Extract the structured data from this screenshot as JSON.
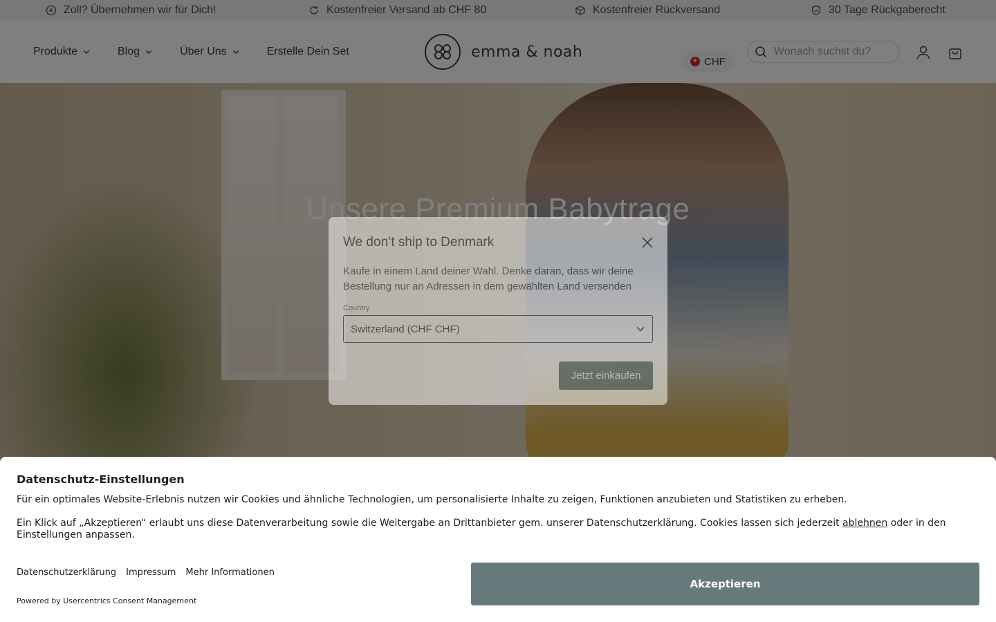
{
  "announcement": {
    "items": [
      {
        "icon": "customs-icon",
        "text": "Zoll? Übernehmen wir für Dich!"
      },
      {
        "icon": "refresh-icon",
        "text": "Kostenfreier Versand ab CHF 80"
      },
      {
        "icon": "box-icon",
        "text": "Kostenfreier Rückversand"
      },
      {
        "icon": "shield-icon",
        "text": "30 Tage Rückgaberecht"
      }
    ]
  },
  "header": {
    "nav": [
      {
        "label": "Produkte",
        "dropdown": true
      },
      {
        "label": "Blog",
        "dropdown": true
      },
      {
        "label": "Über Uns",
        "dropdown": true
      },
      {
        "label": "Erstelle Dein Set",
        "dropdown": false
      }
    ],
    "logo_text": "emma & noah",
    "currency": "CHF",
    "search_placeholder": "Wonach suchst du?"
  },
  "hero": {
    "title": "Unsere Premium Babytrage"
  },
  "modal": {
    "title": "We don’t ship to Denmark",
    "text": "Kaufe in einem Land deiner Wahl. Denke daran, dass wir deine Bestellung nur an Adressen in dem gewählten Land versenden",
    "country_label": "Country",
    "country_value": "Switzerland (CHF CHF)",
    "button": "Jetzt einkaufen"
  },
  "consent": {
    "title": "Datenschutz-Einstellungen",
    "p1": "Für ein optimales Website-Erlebnis nutzen wir Cookies und ähnliche Technologien, um personalisierte Inhalte zu zeigen, Funktionen anzubieten und Statistiken zu erheben.",
    "p2_before": "Ein Klick auf „Akzeptieren“ erlaubt uns diese Datenverarbeitung sowie die Weitergabe an Drittanbieter gem. unserer Datenschutzerklärung. Cookies lassen sich jederzeit ",
    "p2_link": "ablehnen",
    "p2_after": " oder in den Einstellungen anpassen.",
    "links": [
      "Datenschutzerklärung",
      "Impressum",
      "Mehr Informationen"
    ],
    "accept": "Akzeptieren",
    "powered": "Powered by Usercentrics Consent Management"
  },
  "colors": {
    "accent": "#5f7375",
    "accept_button": "#667a7c",
    "overlay": "rgba(0,0,0,0.5)"
  }
}
